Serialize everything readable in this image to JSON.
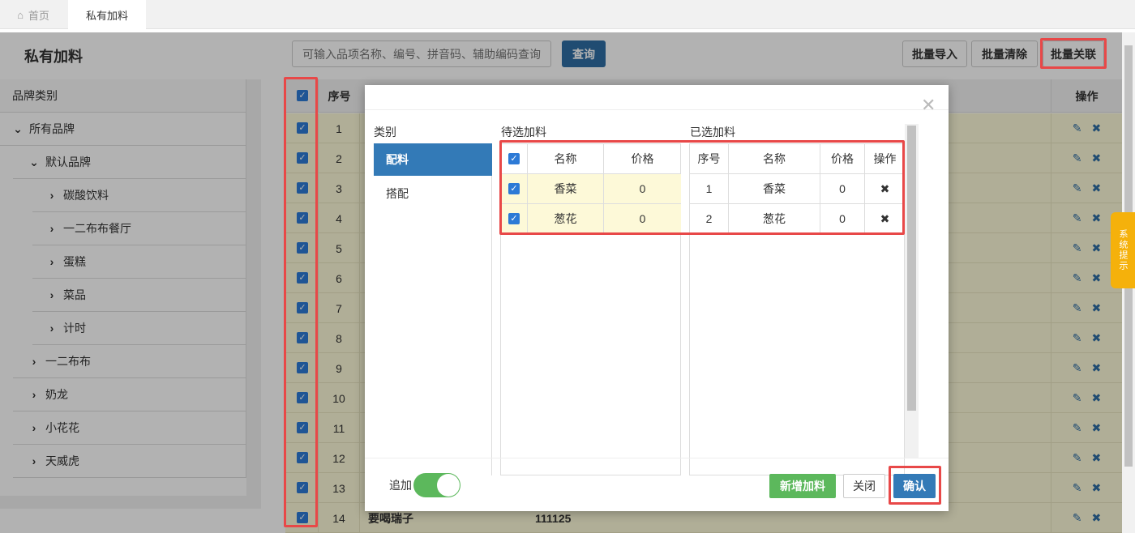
{
  "tabs": {
    "home_label": "首页",
    "active_label": "私有加料"
  },
  "page": {
    "title": "私有加料"
  },
  "search": {
    "placeholder": "可输入品项名称、编号、拼音码、辅助编码查询",
    "button": "查询"
  },
  "actions": {
    "import": "批量导入",
    "clear": "批量清除",
    "link": "批量关联"
  },
  "tree": {
    "header": "品牌类别",
    "items": [
      {
        "label": "所有品牌",
        "level": 0,
        "expanded": true
      },
      {
        "label": "默认品牌",
        "level": 1,
        "expanded": true
      },
      {
        "label": "碳酸饮料",
        "level": 2,
        "expanded": false
      },
      {
        "label": "一二布布餐厅",
        "level": 2,
        "expanded": false
      },
      {
        "label": "蛋糕",
        "level": 2,
        "expanded": false
      },
      {
        "label": "菜品",
        "level": 2,
        "expanded": false
      },
      {
        "label": "计时",
        "level": 2,
        "expanded": false
      },
      {
        "label": "一二布布",
        "level": 0,
        "expanded": false
      },
      {
        "label": "奶龙",
        "level": 0,
        "expanded": false
      },
      {
        "label": "小花花",
        "level": 0,
        "expanded": false
      },
      {
        "label": "天威虎",
        "level": 0,
        "expanded": false
      }
    ]
  },
  "table": {
    "headers": {
      "seq": "序号",
      "ops": "操作"
    },
    "rows": [
      "1",
      "2",
      "3",
      "4",
      "5",
      "6",
      "7",
      "8",
      "9",
      "10",
      "11",
      "12",
      "13",
      "14"
    ],
    "last_row": {
      "name": "要喝瑞子",
      "code": "111125"
    }
  },
  "side_tip": "系统提示",
  "modal": {
    "category_label": "类别",
    "categories": [
      "配料",
      "搭配"
    ],
    "pending_label": "待选加料",
    "selected_label": "已选加料",
    "pending_headers": {
      "name": "名称",
      "price": "价格"
    },
    "pending_rows": [
      {
        "name": "香菜",
        "price": "0"
      },
      {
        "name": "葱花",
        "price": "0"
      }
    ],
    "selected_headers": {
      "seq": "序号",
      "name": "名称",
      "price": "价格",
      "op": "操作"
    },
    "selected_rows": [
      {
        "seq": "1",
        "name": "香菜",
        "price": "0"
      },
      {
        "seq": "2",
        "name": "葱花",
        "price": "0"
      }
    ],
    "append_label": "追加",
    "append_on": true,
    "btn_add": "新增加料",
    "btn_close": "关闭",
    "btn_confirm": "确认"
  },
  "colors": {
    "primary": "#337ab7",
    "highlight": "#e84848",
    "success": "#5cb85c",
    "row_bg": "#fdf9d8",
    "tip": "#f5b10b"
  }
}
